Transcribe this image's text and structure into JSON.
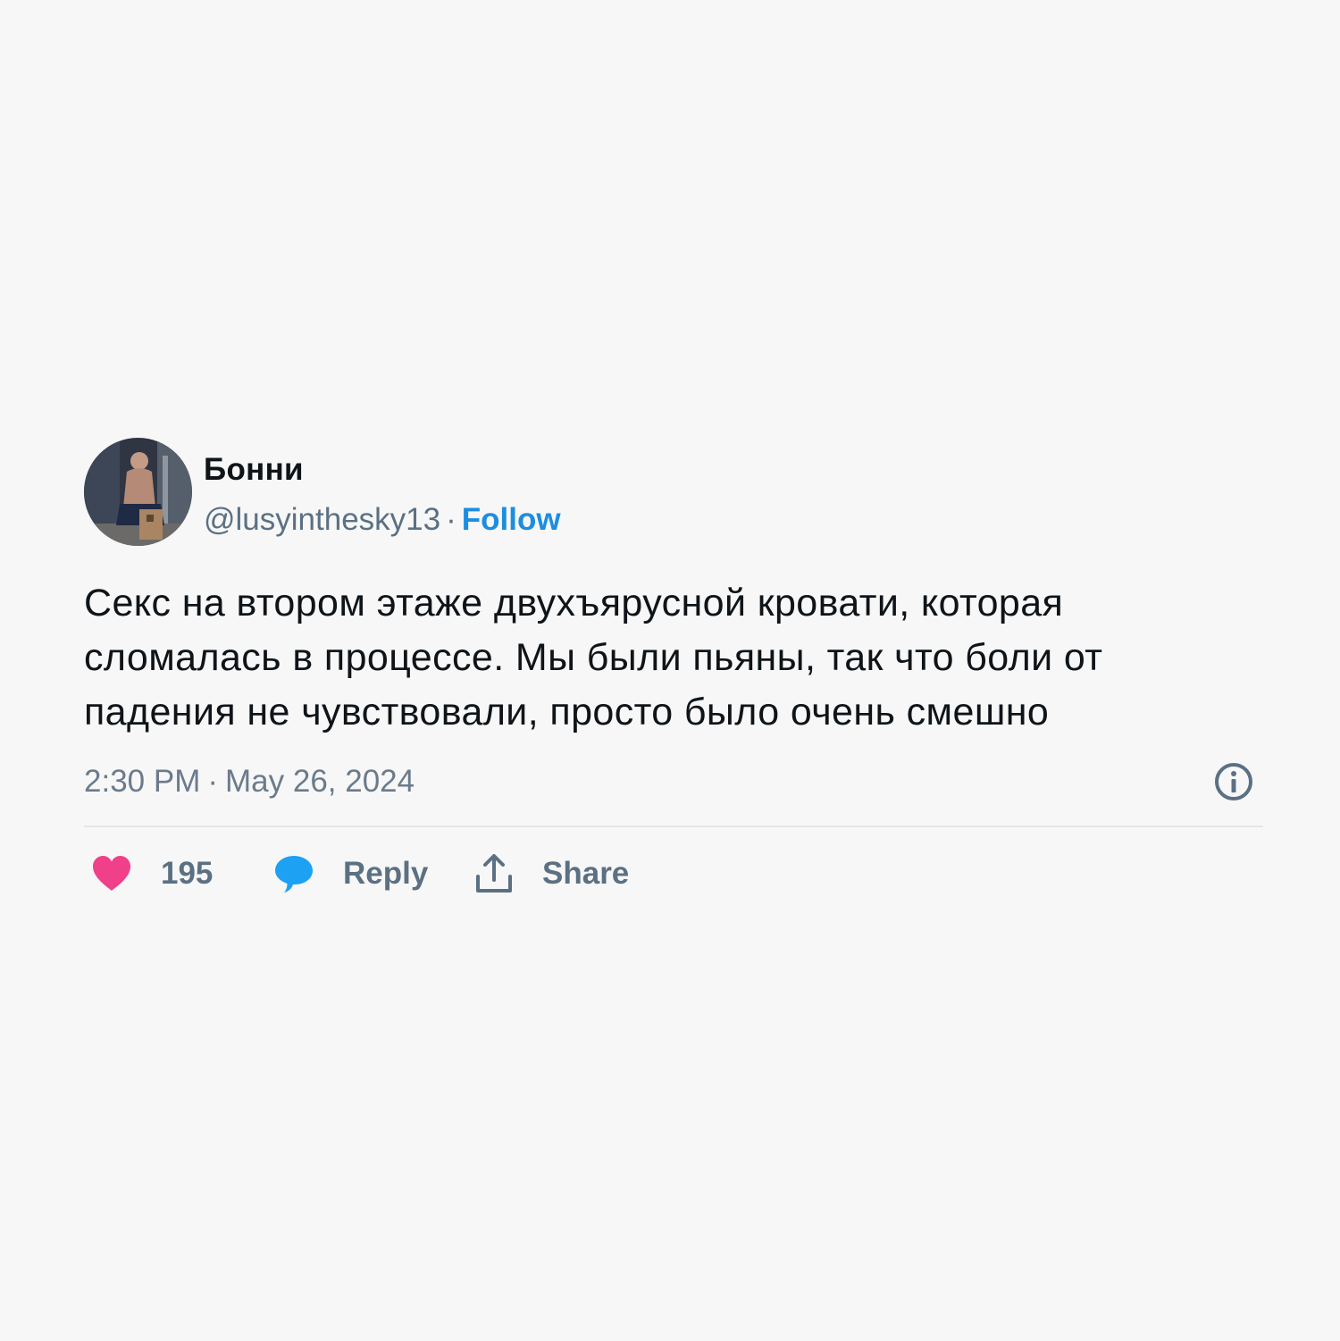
{
  "author": {
    "display_name": "Бонни",
    "handle": "@lusyinthesky13",
    "separator": "·",
    "follow_label": "Follow"
  },
  "tweet": {
    "text": "Секс на втором этаже двухъярусной кровати, которая\nсломалась в процессе. Мы были пьяны, так что боли от\nпадения не чувствовали, просто было очень смешно",
    "time": "2:30 PM",
    "separator": "·",
    "date": "May 26, 2024"
  },
  "actions": {
    "like_count": "195",
    "reply_label": "Reply",
    "share_label": "Share"
  },
  "icons": {
    "like": "heart-icon",
    "reply": "speech-bubble-icon",
    "share": "share-upload-icon",
    "info": "info-icon"
  },
  "colors": {
    "background": "#f7f7f7",
    "text": "#0f1419",
    "secondary": "#5b7083",
    "follow": "#1d8de0",
    "heart": "#f0408a",
    "reply_bubble": "#1da1f2"
  }
}
